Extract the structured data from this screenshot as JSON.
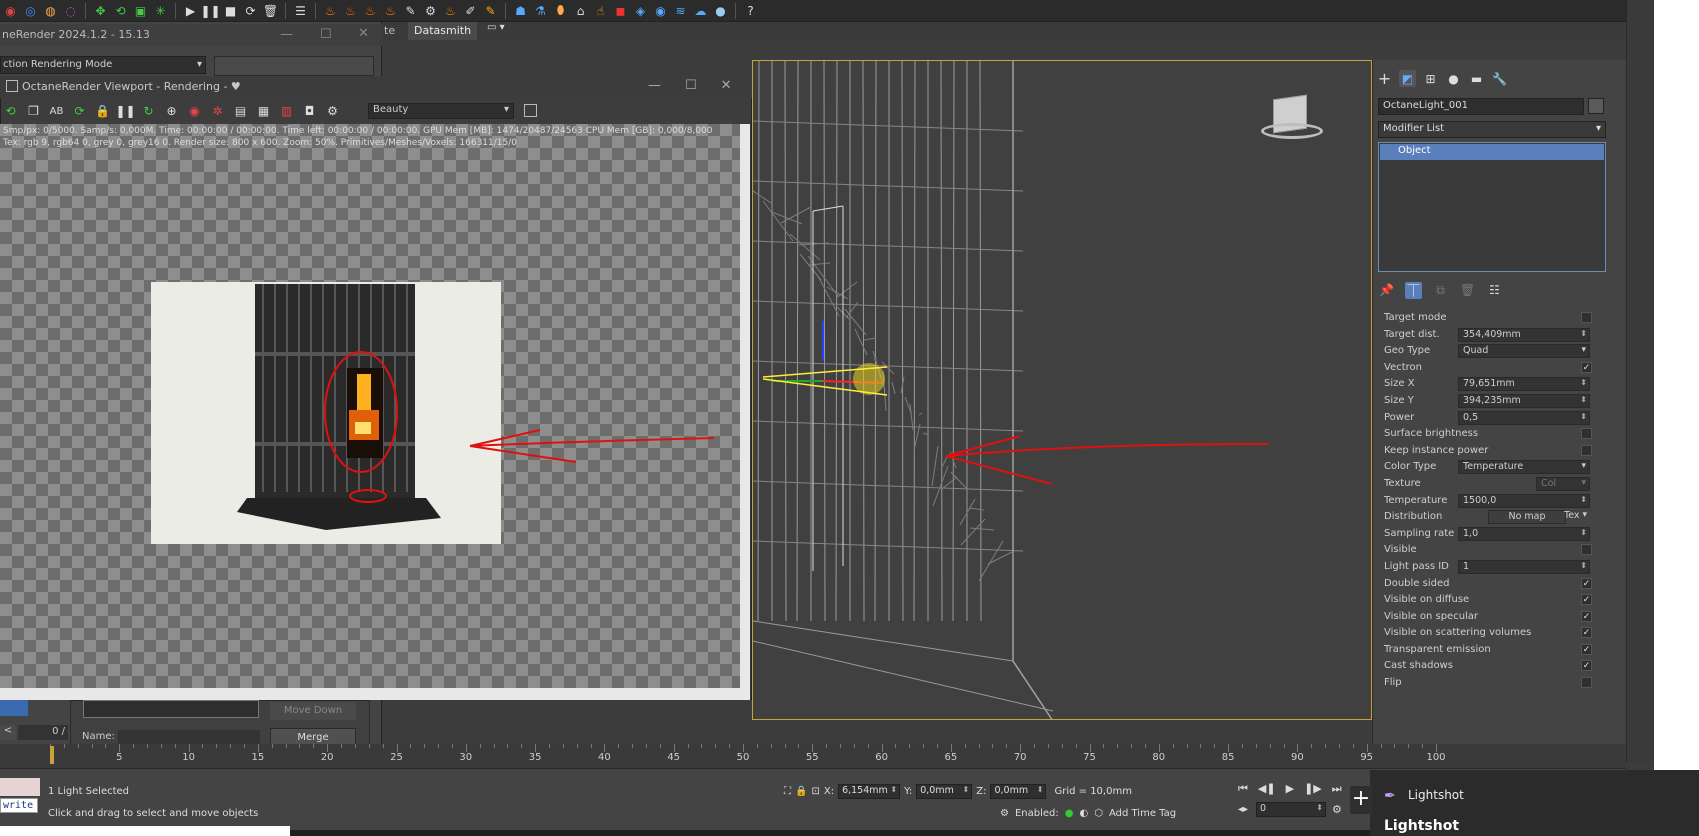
{
  "toolbar": {
    "icons": [
      "snap-2d-icon",
      "snap-icon",
      "angle-snap-icon",
      "percent-snap-icon",
      "move-icon",
      "rotate-icon",
      "scale-icon",
      "select-icon",
      "play-icon",
      "pause-icon",
      "stop-icon",
      "reload-icon",
      "trash-icon",
      "list-icon",
      "fire-icon",
      "fire2-icon",
      "fire3-icon",
      "pipe-icon",
      "paint-icon",
      "gear2-icon",
      "camera-icon",
      "pencil-icon",
      "doc-icon",
      "cup-icon",
      "jug-icon",
      "shape-icon",
      "box-icon",
      "hand-icon",
      "globe-icon",
      "boat-icon",
      "sphere-icon",
      "help-icon"
    ],
    "help": "?"
  },
  "menu": {
    "partial_tab": "te",
    "datasmith": "Datasmith",
    "dropdown": "▾"
  },
  "bg_octane": {
    "title": "neRender 2024.1.2 - 15.13",
    "mode": "ction Rendering Mode"
  },
  "octane_viewport": {
    "title": "OctaneRender Viewport - Rendering - ♥",
    "pass": "Beauty",
    "stats_line1": "Smp/px: 0/5000.    Samp/s: 0,000M.    Time: 00:00:00 / 00:00:00.    Time left: 00:00:00 / 00:00:00.    GPU Mem [MB]: 1474/20487/24563    CPU Mem [GB]: 0,000/8,000",
    "stats_line2": "Tex: rgb 9, rgb64 0, grey 0, grey16 0.    Render size: 800 x 600.    Zoom: 50%.    Primitives/Meshes/Voxels: 166311/15/0",
    "toolbar_buttons": [
      "AB"
    ]
  },
  "command_panel": {
    "object_name": "OctaneLight_001",
    "modifier_list": "Modifier List",
    "stack_item": "Object",
    "params": [
      {
        "label": "Target mode",
        "kind": "check",
        "checked": ""
      },
      {
        "label": "Target dist.",
        "kind": "spin",
        "value": "354,409mm"
      },
      {
        "label": "Geo Type",
        "kind": "dd",
        "value": "Quad"
      },
      {
        "label": "Vectron",
        "kind": "check",
        "checked": "✓"
      },
      {
        "label": "Size X",
        "kind": "spin",
        "value": "79,651mm"
      },
      {
        "label": "Size Y",
        "kind": "spin",
        "value": "394,235mm"
      },
      {
        "label": "Power",
        "kind": "spin",
        "value": "0,5"
      },
      {
        "label": "Surface brightness",
        "kind": "check",
        "checked": ""
      },
      {
        "label": "Keep instance power",
        "kind": "check",
        "checked": ""
      },
      {
        "label": "Color Type",
        "kind": "dd",
        "value": "Temperature"
      },
      {
        "label": "Texture",
        "kind": "tex",
        "value": "Col"
      },
      {
        "label": "Temperature",
        "kind": "spin",
        "value": "1500,0"
      },
      {
        "label": "Distribution",
        "kind": "dist",
        "value": "No map",
        "extra": "Tex"
      },
      {
        "label": "Sampling rate",
        "kind": "spin",
        "value": "1,0"
      },
      {
        "label": "Visible",
        "kind": "check",
        "checked": ""
      },
      {
        "label": "Light pass ID",
        "kind": "spin",
        "value": "1"
      },
      {
        "label": "Double sided",
        "kind": "check",
        "checked": "✓"
      },
      {
        "label": "Visible on diffuse",
        "kind": "check",
        "checked": "✓"
      },
      {
        "label": "Visible on specular",
        "kind": "check",
        "checked": "✓"
      },
      {
        "label": "Visible on scattering volumes",
        "kind": "check",
        "checked": "✓"
      },
      {
        "label": "Transparent emission",
        "kind": "check",
        "checked": "✓"
      },
      {
        "label": "Cast shadows",
        "kind": "check",
        "checked": "✓"
      },
      {
        "label": "Flip",
        "kind": "check",
        "checked": ""
      }
    ]
  },
  "merge_panel": {
    "move_down": "Move Down",
    "name_label": "Name:",
    "merge": "Merge"
  },
  "timeline": {
    "back": "<",
    "frame": "0 /",
    "ticks": [
      5,
      10,
      15,
      20,
      25,
      30,
      35,
      40,
      45,
      50,
      55,
      60,
      65,
      70,
      75,
      80,
      85,
      90,
      95,
      100
    ]
  },
  "status": {
    "write": "write",
    "selection": "1 Light Selected",
    "hint": "Click and drag to select and move objects",
    "x_label": "X:",
    "x": "6,154mm",
    "y_label": "Y:",
    "y": "0,0mm",
    "z_label": "Z:",
    "z": "0,0mm",
    "grid": "Grid = 10,0mm",
    "enabled": "Enabled:",
    "add_time_tag": "Add Time Tag",
    "current_frame": "0"
  },
  "lightshot": {
    "label": "Lightshot",
    "title": "Lightshot"
  }
}
